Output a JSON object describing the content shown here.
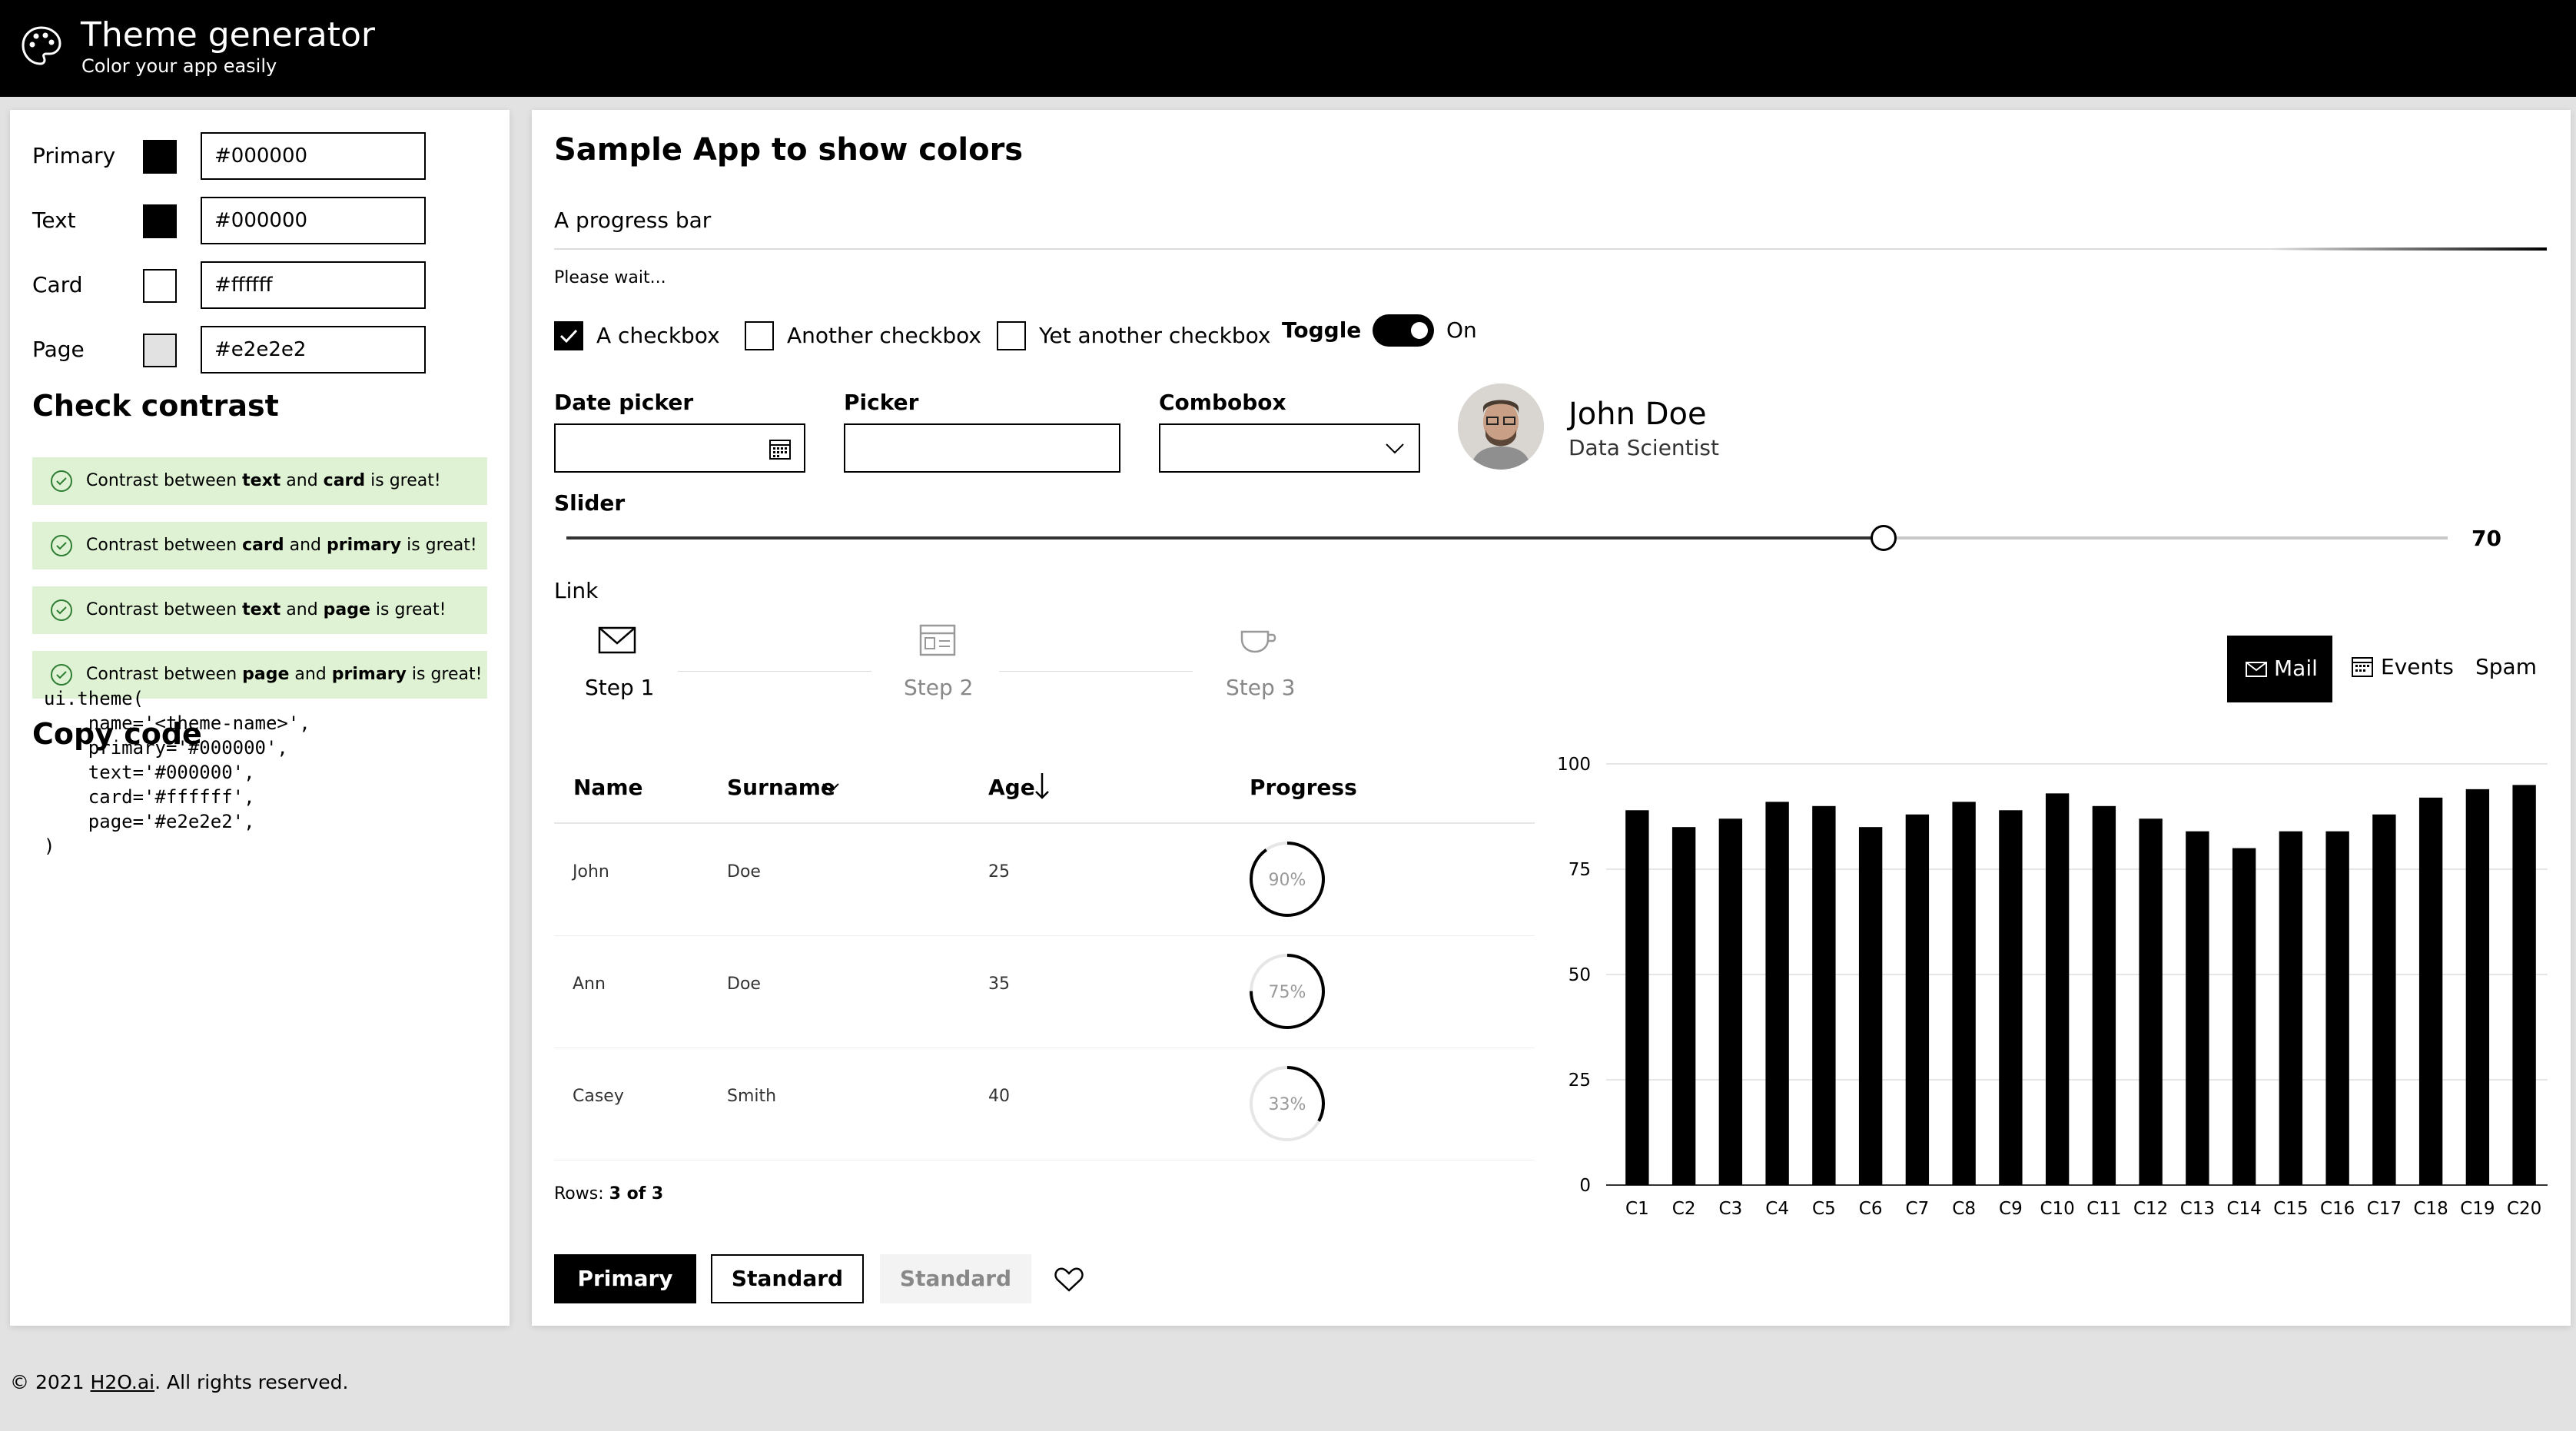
{
  "header": {
    "title": "Theme generator",
    "subtitle": "Color your app easily",
    "icon": "palette-icon"
  },
  "colors": [
    {
      "label": "Primary",
      "value": "#000000",
      "swatch": "#000000"
    },
    {
      "label": "Text",
      "value": "#000000",
      "swatch": "#000000"
    },
    {
      "label": "Card",
      "value": "#ffffff",
      "swatch": "#ffffff"
    },
    {
      "label": "Page",
      "value": "#e2e2e2",
      "swatch": "#e2e2e2"
    }
  ],
  "contrast": {
    "heading": "Check contrast",
    "messages": [
      {
        "pre": "Contrast between ",
        "a": "text",
        "mid": " and ",
        "b": "card",
        "post": " is great!"
      },
      {
        "pre": "Contrast between ",
        "a": "card",
        "mid": " and ",
        "b": "primary",
        "post": " is great!"
      },
      {
        "pre": "Contrast between ",
        "a": "text",
        "mid": " and ",
        "b": "page",
        "post": " is great!"
      },
      {
        "pre": "Contrast between ",
        "a": "page",
        "mid": " and ",
        "b": "primary",
        "post": " is great!"
      }
    ]
  },
  "copy_code": {
    "heading": "Copy code",
    "code": "ui.theme(\n    name='<theme-name>',\n    primary='#000000',\n    text='#000000',\n    card='#ffffff',\n    page='#e2e2e2',\n)"
  },
  "sample": {
    "title": "Sample App to show colors",
    "progress_label": "A progress bar",
    "progress_caption": "Please wait...",
    "checkboxes": [
      {
        "label": "A checkbox",
        "checked": true
      },
      {
        "label": "Another checkbox",
        "checked": false
      },
      {
        "label": "Yet another checkbox",
        "checked": false
      }
    ],
    "toggle": {
      "label": "Toggle",
      "state": "On"
    },
    "date_picker_label": "Date picker",
    "picker_label": "Picker",
    "combobox_label": "Combobox",
    "persona": {
      "name": "John Doe",
      "role": "Data Scientist"
    },
    "slider": {
      "label": "Slider",
      "value": "70",
      "fraction": 0.7
    },
    "link": "Link",
    "steps": [
      "Step 1",
      "Step 2",
      "Step 3"
    ],
    "tabs": [
      "Mail",
      "Events",
      "Spam"
    ],
    "table": {
      "headers": [
        "Name",
        "Surname",
        "Age",
        "Progress"
      ],
      "rows": [
        {
          "name": "John",
          "surname": "Doe",
          "age": "25",
          "progress": "90%",
          "fraction": 0.9
        },
        {
          "name": "Ann",
          "surname": "Doe",
          "age": "35",
          "progress": "75%",
          "fraction": 0.75
        },
        {
          "name": "Casey",
          "surname": "Smith",
          "age": "40",
          "progress": "33%",
          "fraction": 0.33
        }
      ],
      "rows_label": "Rows:",
      "rows_count": "3 of 3"
    },
    "buttons": {
      "primary": "Primary",
      "standard": "Standard",
      "disabled": "Standard"
    }
  },
  "chart_data": {
    "type": "bar",
    "categories": [
      "C1",
      "C2",
      "C3",
      "C4",
      "C5",
      "C6",
      "C7",
      "C8",
      "C9",
      "C10",
      "C11",
      "C12",
      "C13",
      "C14",
      "C15",
      "C16",
      "C17",
      "C18",
      "C19",
      "C20"
    ],
    "values": [
      89,
      85,
      87,
      91,
      90,
      85,
      88,
      91,
      89,
      93,
      90,
      87,
      84,
      80,
      84,
      84,
      88,
      92,
      94,
      95
    ],
    "ylim": [
      0,
      100
    ],
    "yticks": [
      "0",
      "25",
      "50",
      "75",
      "100"
    ],
    "grid": true,
    "color": "#000000"
  },
  "footer": {
    "pre": "© 2021 ",
    "link": "H2O.ai",
    "post": ". All rights reserved."
  }
}
